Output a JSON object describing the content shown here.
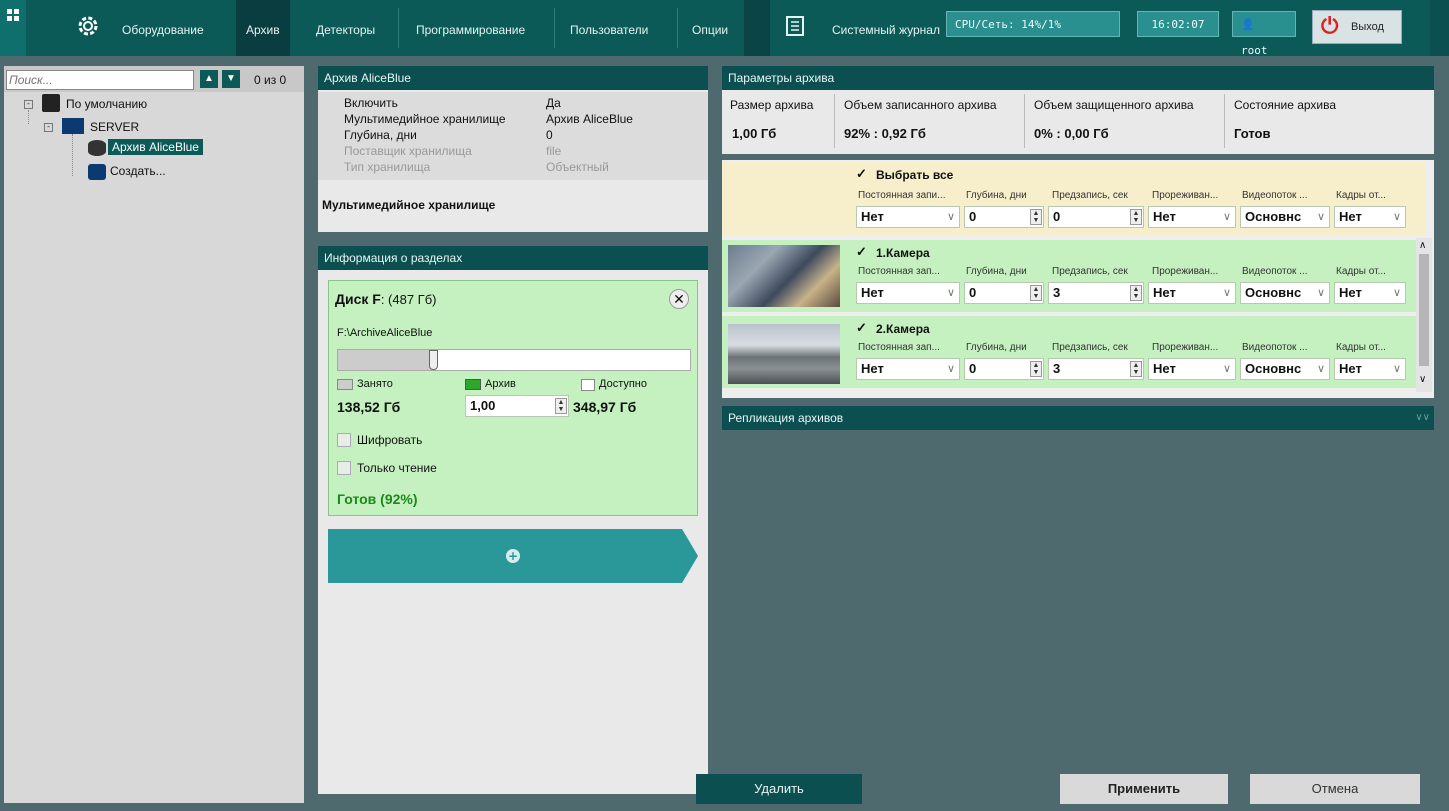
{
  "topbar": {
    "tabs": [
      "Оборудование",
      "Архив",
      "Детекторы",
      "Программирование",
      "Пользователи",
      "Опции"
    ],
    "active_tab": "Архив",
    "journal": "Системный журнал",
    "cpu": "CPU/Сеть: 14%/1%",
    "time": "16:02:07",
    "user": "root",
    "exit": "Выход"
  },
  "tree": {
    "search_placeholder": "Поиск...",
    "counter": "0 из 0",
    "items": [
      "По умолчанию",
      "SERVER",
      "Архив AliceBlue",
      "Создать..."
    ]
  },
  "archive_props": {
    "title": "Архив AliceBlue",
    "rows": [
      {
        "k": "Включить",
        "v": "Да"
      },
      {
        "k": "Мультимедийное хранилище",
        "v": "Архив AliceBlue"
      },
      {
        "k": "Глубина, дни",
        "v": "0"
      },
      {
        "k": "Поставщик хранилища",
        "v": "file"
      },
      {
        "k": "Тип хранилища",
        "v": "Объектный"
      }
    ],
    "description": "Мультимедийное хранилище"
  },
  "partitions": {
    "title": "Информация о разделах",
    "disk_label": "Диск F",
    "disk_size": ": (487 Гб)",
    "path": "F:\\ArchiveAliceBlue",
    "legend_used": "Занято",
    "legend_archive": "Архив",
    "legend_free": "Доступно",
    "used_value": "138,52 Гб",
    "archive_value": "1,00",
    "free_value": "348,97 Гб",
    "encrypt": "Шифровать",
    "readonly": "Только чтение",
    "status": "Готов (92%)",
    "used_fraction": 0.27
  },
  "params": {
    "title": "Параметры архива",
    "cols": [
      "Размер архива",
      "Объем записанного архива",
      "Объем защищенного архива",
      "Состояние архива"
    ],
    "vals": [
      "1,00 Гб",
      "92% : 0,92 Гб",
      "0% : 0,00 Гб",
      "Готов"
    ]
  },
  "cameras": {
    "labels": [
      "Постоянная зап...",
      "Глубина, дни",
      "Предзапись, сек",
      "Прореживан...",
      "Видеопоток ...",
      "Кадры от..."
    ],
    "select_all": {
      "name": "Выбрать все",
      "labels": [
        "Постоянная запи...",
        "Глубина, дни",
        "Предзапись, сек",
        "Прореживан...",
        "Видеопоток ...",
        "Кадры от..."
      ],
      "values": [
        "Нет",
        "0",
        "0",
        "Нет",
        "Основнс",
        "Нет"
      ]
    },
    "rows": [
      {
        "name": "1.Камера",
        "values": [
          "Нет",
          "0",
          "3",
          "Нет",
          "Основнс",
          "Нет"
        ]
      },
      {
        "name": "2.Камера",
        "values": [
          "Нет",
          "0",
          "3",
          "Нет",
          "Основнс",
          "Нет"
        ]
      }
    ]
  },
  "replication": "Репликация архивов",
  "buttons": {
    "delete": "Удалить",
    "apply": "Применить",
    "cancel": "Отмена"
  },
  "colors": {
    "accent": "#0b5a58",
    "ready_green": "#1a8a1a"
  }
}
